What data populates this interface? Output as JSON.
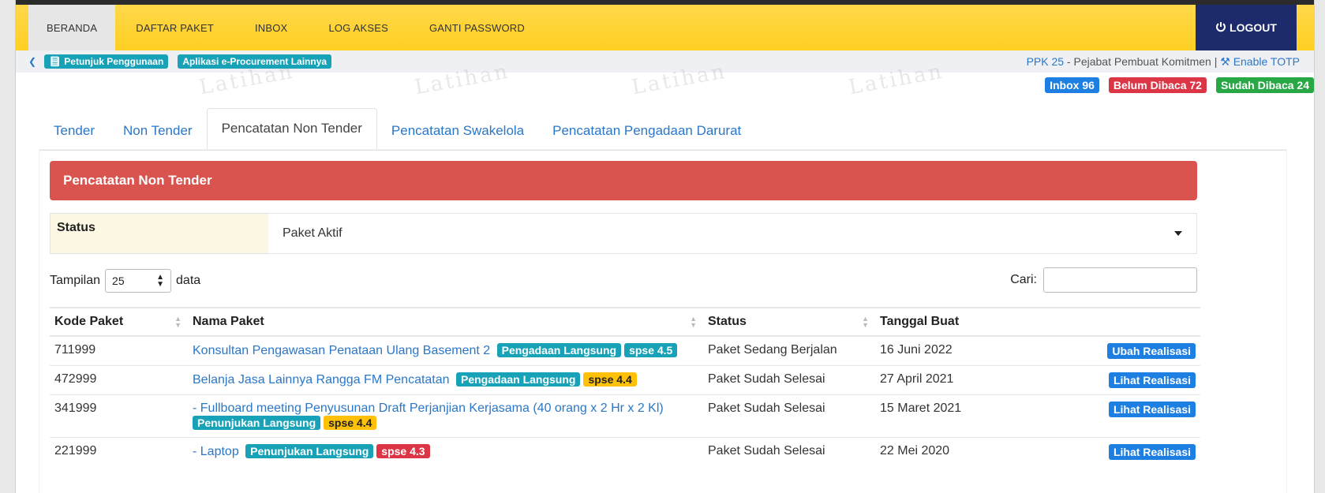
{
  "topnav": {
    "items": [
      "BERANDA",
      "DAFTAR PAKET",
      "INBOX",
      "LOG AKSES",
      "GANTI PASSWORD"
    ],
    "logout_label": "LOGOUT"
  },
  "subbar": {
    "guide_label": "Petunjuk Penggunaan",
    "eproc_label": "Aplikasi e-Procurement Lainnya",
    "user_name": "PPK 25",
    "user_role": " - Pejabat Pembuat Komitmen | ",
    "totp_label": "Enable TOTP"
  },
  "watermark_text": "Latihan",
  "inbox": {
    "inbox": "Inbox 96",
    "unread": "Belum Dibaca 72",
    "read": "Sudah Dibaca 24"
  },
  "tabs": [
    "Tender",
    "Non Tender",
    "Pencatatan Non Tender",
    "Pencatatan Swakelola",
    "Pencatatan Pengadaan Darurat"
  ],
  "panel": {
    "title": "Pencatatan Non Tender",
    "status_label": "Status",
    "status_value": "Paket Aktif"
  },
  "table_controls": {
    "show_label": "Tampilan",
    "show_value": "25",
    "show_suffix": "data",
    "search_label": "Cari:"
  },
  "table": {
    "headers": [
      "Kode Paket",
      "Nama Paket",
      "Status",
      "Tanggal Buat"
    ],
    "rows": [
      {
        "kode": "711999",
        "nama": "Konsultan Pengawasan Penataan Ulang Basement 2",
        "metode": "Pengadaan Langsung",
        "versi": "spse 4.5",
        "status": "Paket Sedang Berjalan",
        "tanggal": "16 Juni 2022",
        "aksi": "Ubah Realisasi"
      },
      {
        "kode": "472999",
        "nama": "Belanja Jasa Lainnya Rangga FM Pencatatan",
        "metode": "Pengadaan Langsung",
        "versi": "spse 4.4",
        "status": "Paket Sudah Selesai",
        "tanggal": "27 April 2021",
        "aksi": "Lihat Realisasi"
      },
      {
        "kode": "341999",
        "nama": "- Fullboard meeting Penyusunan Draft Perjanjian Kerjasama (40 orang x 2 Hr x 2 Kl)",
        "metode": "Penunjukan Langsung",
        "versi": "spse 4.4",
        "status": "Paket Sudah Selesai",
        "tanggal": "15 Maret 2021",
        "aksi": "Lihat Realisasi"
      },
      {
        "kode": "221999",
        "nama": "- Laptop",
        "metode": "Penunjukan Langsung",
        "versi": "spse 4.3",
        "status": "Paket Sudah Selesai",
        "tanggal": "22 Mei 2020",
        "aksi": "Lihat Realisasi"
      }
    ]
  },
  "colors": {
    "nav_yellow": "#ffd84a",
    "logout_bg": "#1d2a6b",
    "panel_red": "#d9534f",
    "link_blue": "#2a77c9",
    "label_teal": "#17a2b8",
    "spse_45": "#17a2b8",
    "spse_44": "#ffc107",
    "spse_43": "#dc3545"
  }
}
